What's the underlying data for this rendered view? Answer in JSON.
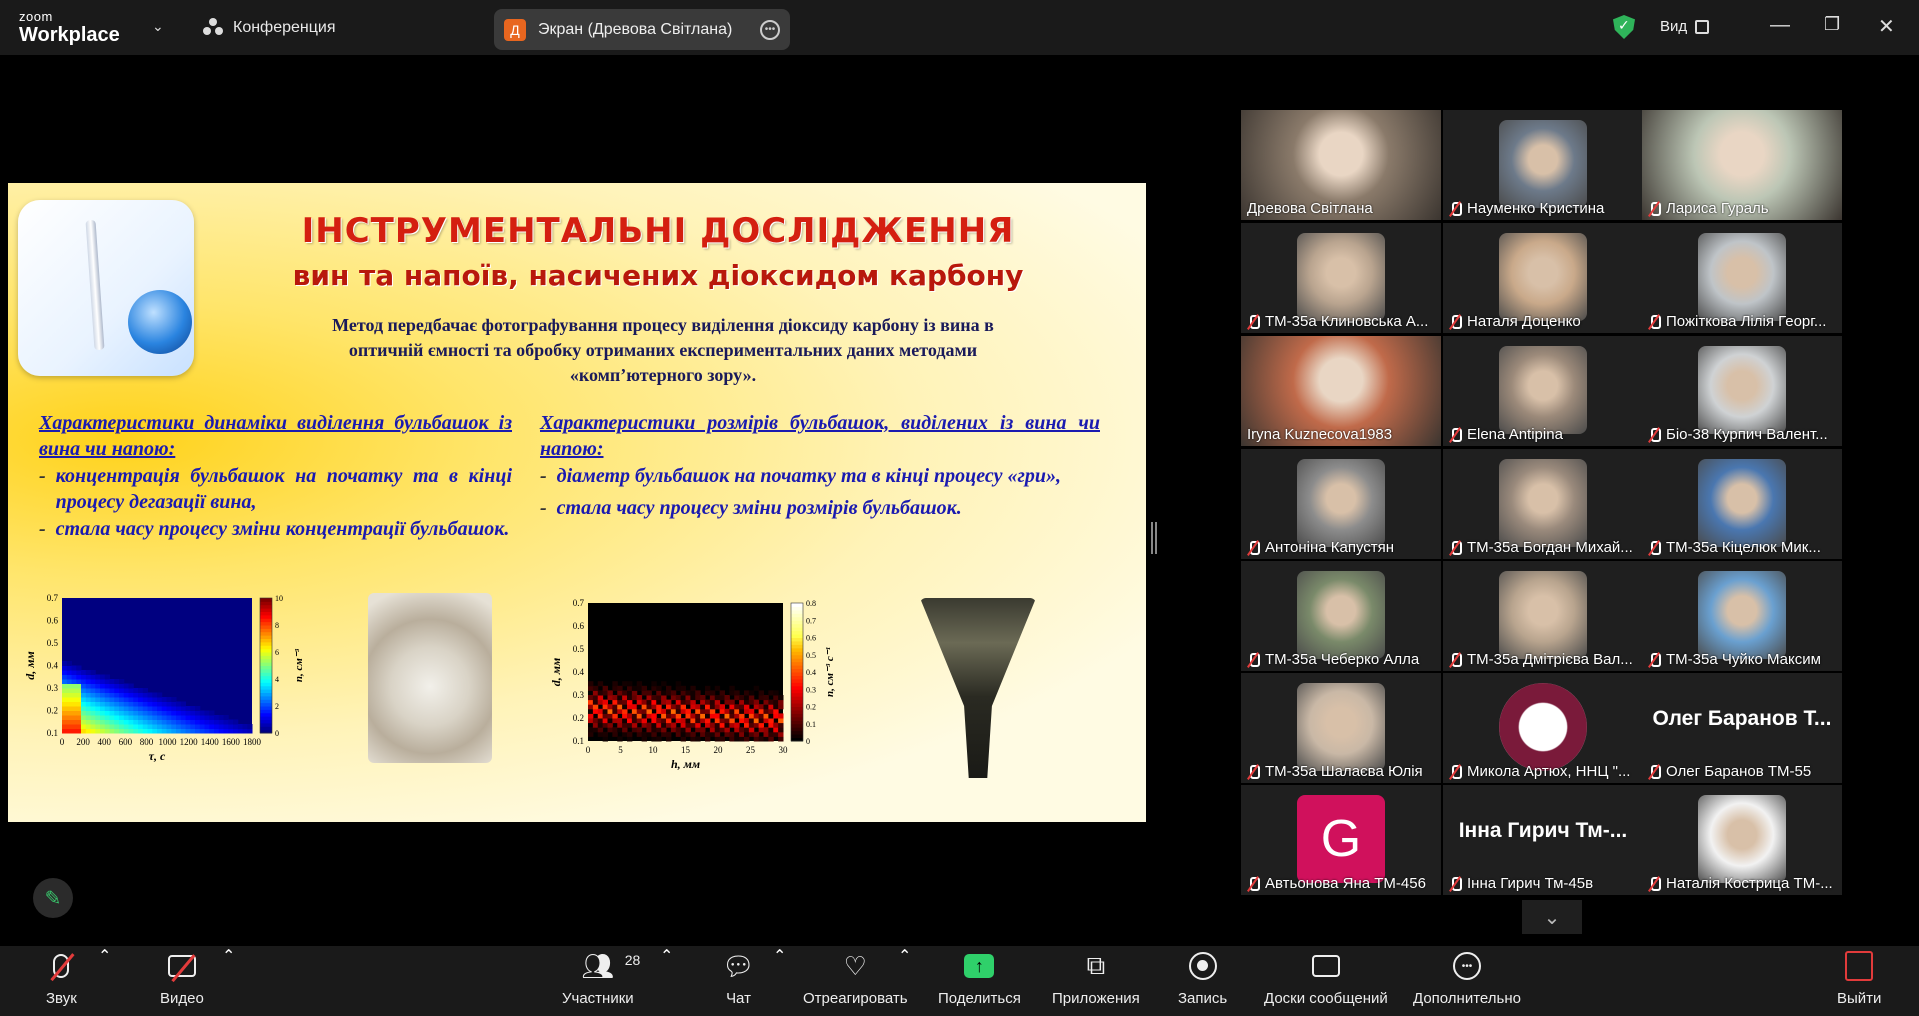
{
  "app": {
    "brand_top": "zoom",
    "brand_bottom": "Workplace"
  },
  "topbar": {
    "conference_label": "Конференция",
    "screen_avatar_letter": "Д",
    "screen_label": "Экран (Древова Світлана)",
    "view_label": "Вид",
    "shield_color": "#2fb45a"
  },
  "slide": {
    "title": "ІНСТРУМЕНТАЛЬНІ ДОСЛІДЖЕННЯ",
    "subtitle": "вин та напоїв, насичених діоксидом карбону",
    "method_line1": "Метод передбачає фотографування процесу виділення діоксиду карбону із вина в",
    "method_line2": "оптичній ємності та обробку отриманих експериментальних даних методами",
    "method_line3": "«комп’ютерного зору».",
    "left_heading": "Характеристики динаміки виділення бульбашок із вина чи напою:",
    "left_items": [
      "концентрація бульбашок на початку та в кінці процесу дегазації вина,",
      "стала часу процесу зміни концентрації бульбашок."
    ],
    "right_heading": "Характеристики розмірів бульбашок, виділених із вина чи напою:",
    "right_items": [
      "діаметр бульбашок на початку та в кінці процесу «гри»,",
      "стала часу процесу зміни розмірів бульбашок."
    ]
  },
  "chart_data": [
    {
      "type": "heatmap",
      "xlabel": "τ, с",
      "ylabel": "d, мм",
      "colorbar_label": "n, см⁻³",
      "x_ticks": [
        "0",
        "200",
        "400",
        "600",
        "800",
        "1000",
        "1200",
        "1400",
        "1600",
        "1800"
      ],
      "y_ticks": [
        "0.1",
        "0.2",
        "0.3",
        "0.4",
        "0.5",
        "0.6",
        "0.7"
      ],
      "colorbar_ticks": [
        "0",
        "2",
        "4",
        "6",
        "8",
        "10"
      ],
      "xlim": [
        0,
        2000
      ],
      "ylim": [
        0.1,
        0.7
      ],
      "clim": [
        0,
        10
      ],
      "colormap": "jet"
    },
    {
      "type": "heatmap",
      "xlabel": "h, мм",
      "ylabel": "d, мм",
      "colorbar_label": "n, см⁻³ с⁻¹",
      "x_ticks": [
        "0",
        "5",
        "10",
        "15",
        "20",
        "25",
        "30"
      ],
      "y_ticks": [
        "0.1",
        "0.2",
        "0.3",
        "0.4",
        "0.5",
        "0.6",
        "0.7"
      ],
      "colorbar_ticks": [
        "0",
        "0.1",
        "0.2",
        "0.3",
        "0.4",
        "0.5",
        "0.6",
        "0.7",
        "0.8"
      ],
      "xlim": [
        0,
        30
      ],
      "ylim": [
        0.1,
        0.7
      ],
      "clim": [
        0,
        0.8
      ],
      "colormap": "hot"
    }
  ],
  "participants": [
    {
      "name": "Древова Світлана",
      "muted": false,
      "active": true,
      "bg": "#8a7a6a",
      "kind": "video"
    },
    {
      "name": "Науменко Кристина",
      "muted": true,
      "bg": "#6d7a8a",
      "kind": "thumb"
    },
    {
      "name": "Лариса Гураль",
      "muted": true,
      "bg": "#bcc6b5",
      "kind": "video"
    },
    {
      "name": "ТМ-35а Клиновська А...",
      "muted": true,
      "bg": "#b9a48f",
      "kind": "thumb"
    },
    {
      "name": "Наталя Доценко",
      "muted": true,
      "bg": "#c9a98a",
      "kind": "thumb"
    },
    {
      "name": "Пожіткова Лілія Георг...",
      "muted": true,
      "bg": "#bfc4c8",
      "kind": "thumb"
    },
    {
      "name": "Iryna Kuznecova1983",
      "muted": false,
      "bg": "#c06a4a",
      "kind": "video"
    },
    {
      "name": "Elena Antipina",
      "muted": true,
      "bg": "#9c8a7a",
      "kind": "thumb"
    },
    {
      "name": "Біо-38 Курпич Валент...",
      "muted": true,
      "bg": "#cfd2d4",
      "kind": "thumb"
    },
    {
      "name": "Антоніна Капустян",
      "muted": true,
      "bg": "#8c8c8c",
      "kind": "thumb"
    },
    {
      "name": "ТМ-35а Богдан Михай...",
      "muted": true,
      "bg": "#9a8a7c",
      "kind": "thumb"
    },
    {
      "name": "ТМ-35а Кіцелюк Мик...",
      "muted": true,
      "bg": "#4a77b0",
      "kind": "thumb"
    },
    {
      "name": "ТМ-35а Чеберко Алла",
      "muted": true,
      "bg": "#7a8a6a",
      "kind": "thumb"
    },
    {
      "name": "ТМ-35а Дмітрієва Вал...",
      "muted": true,
      "bg": "#b8a48e",
      "kind": "thumb"
    },
    {
      "name": "ТМ-35а Чуйко Максим",
      "muted": true,
      "bg": "#6aa0d0",
      "kind": "thumb"
    },
    {
      "name": "ТМ-35а Шалаєва Юлія",
      "muted": true,
      "bg": "#c9b8a6",
      "kind": "thumb"
    },
    {
      "name": "Микола Артюх, ННЦ \"...",
      "muted": true,
      "bg": "#7a1a3a",
      "kind": "logo"
    },
    {
      "name": "Олег Баранов ТМ-55",
      "muted": true,
      "bg": "#1f1f1f",
      "kind": "bigname",
      "big": "Олег Баранов Т..."
    },
    {
      "name": "Автьонова Яна ТМ-456",
      "muted": true,
      "bg": "#1f1f1f",
      "kind": "avatar",
      "letter": "G"
    },
    {
      "name": "Інна Гирич Тм-45в",
      "muted": true,
      "bg": "#1f1f1f",
      "kind": "bigname",
      "big": "Інна Гирич Тм-..."
    },
    {
      "name": "Наталія Кострица ТМ-...",
      "muted": true,
      "bg": "#f2f2f2",
      "kind": "thumb"
    }
  ],
  "toolbar": {
    "audio": "Звук",
    "video": "Видео",
    "participants": "Участники",
    "participants_count": "28",
    "chat": "Чат",
    "react": "Отреагировать",
    "share": "Поделиться",
    "apps": "Приложения",
    "record": "Запись",
    "whiteboards": "Доски сообщений",
    "more": "Дополнительно",
    "leave": "Выйти"
  }
}
